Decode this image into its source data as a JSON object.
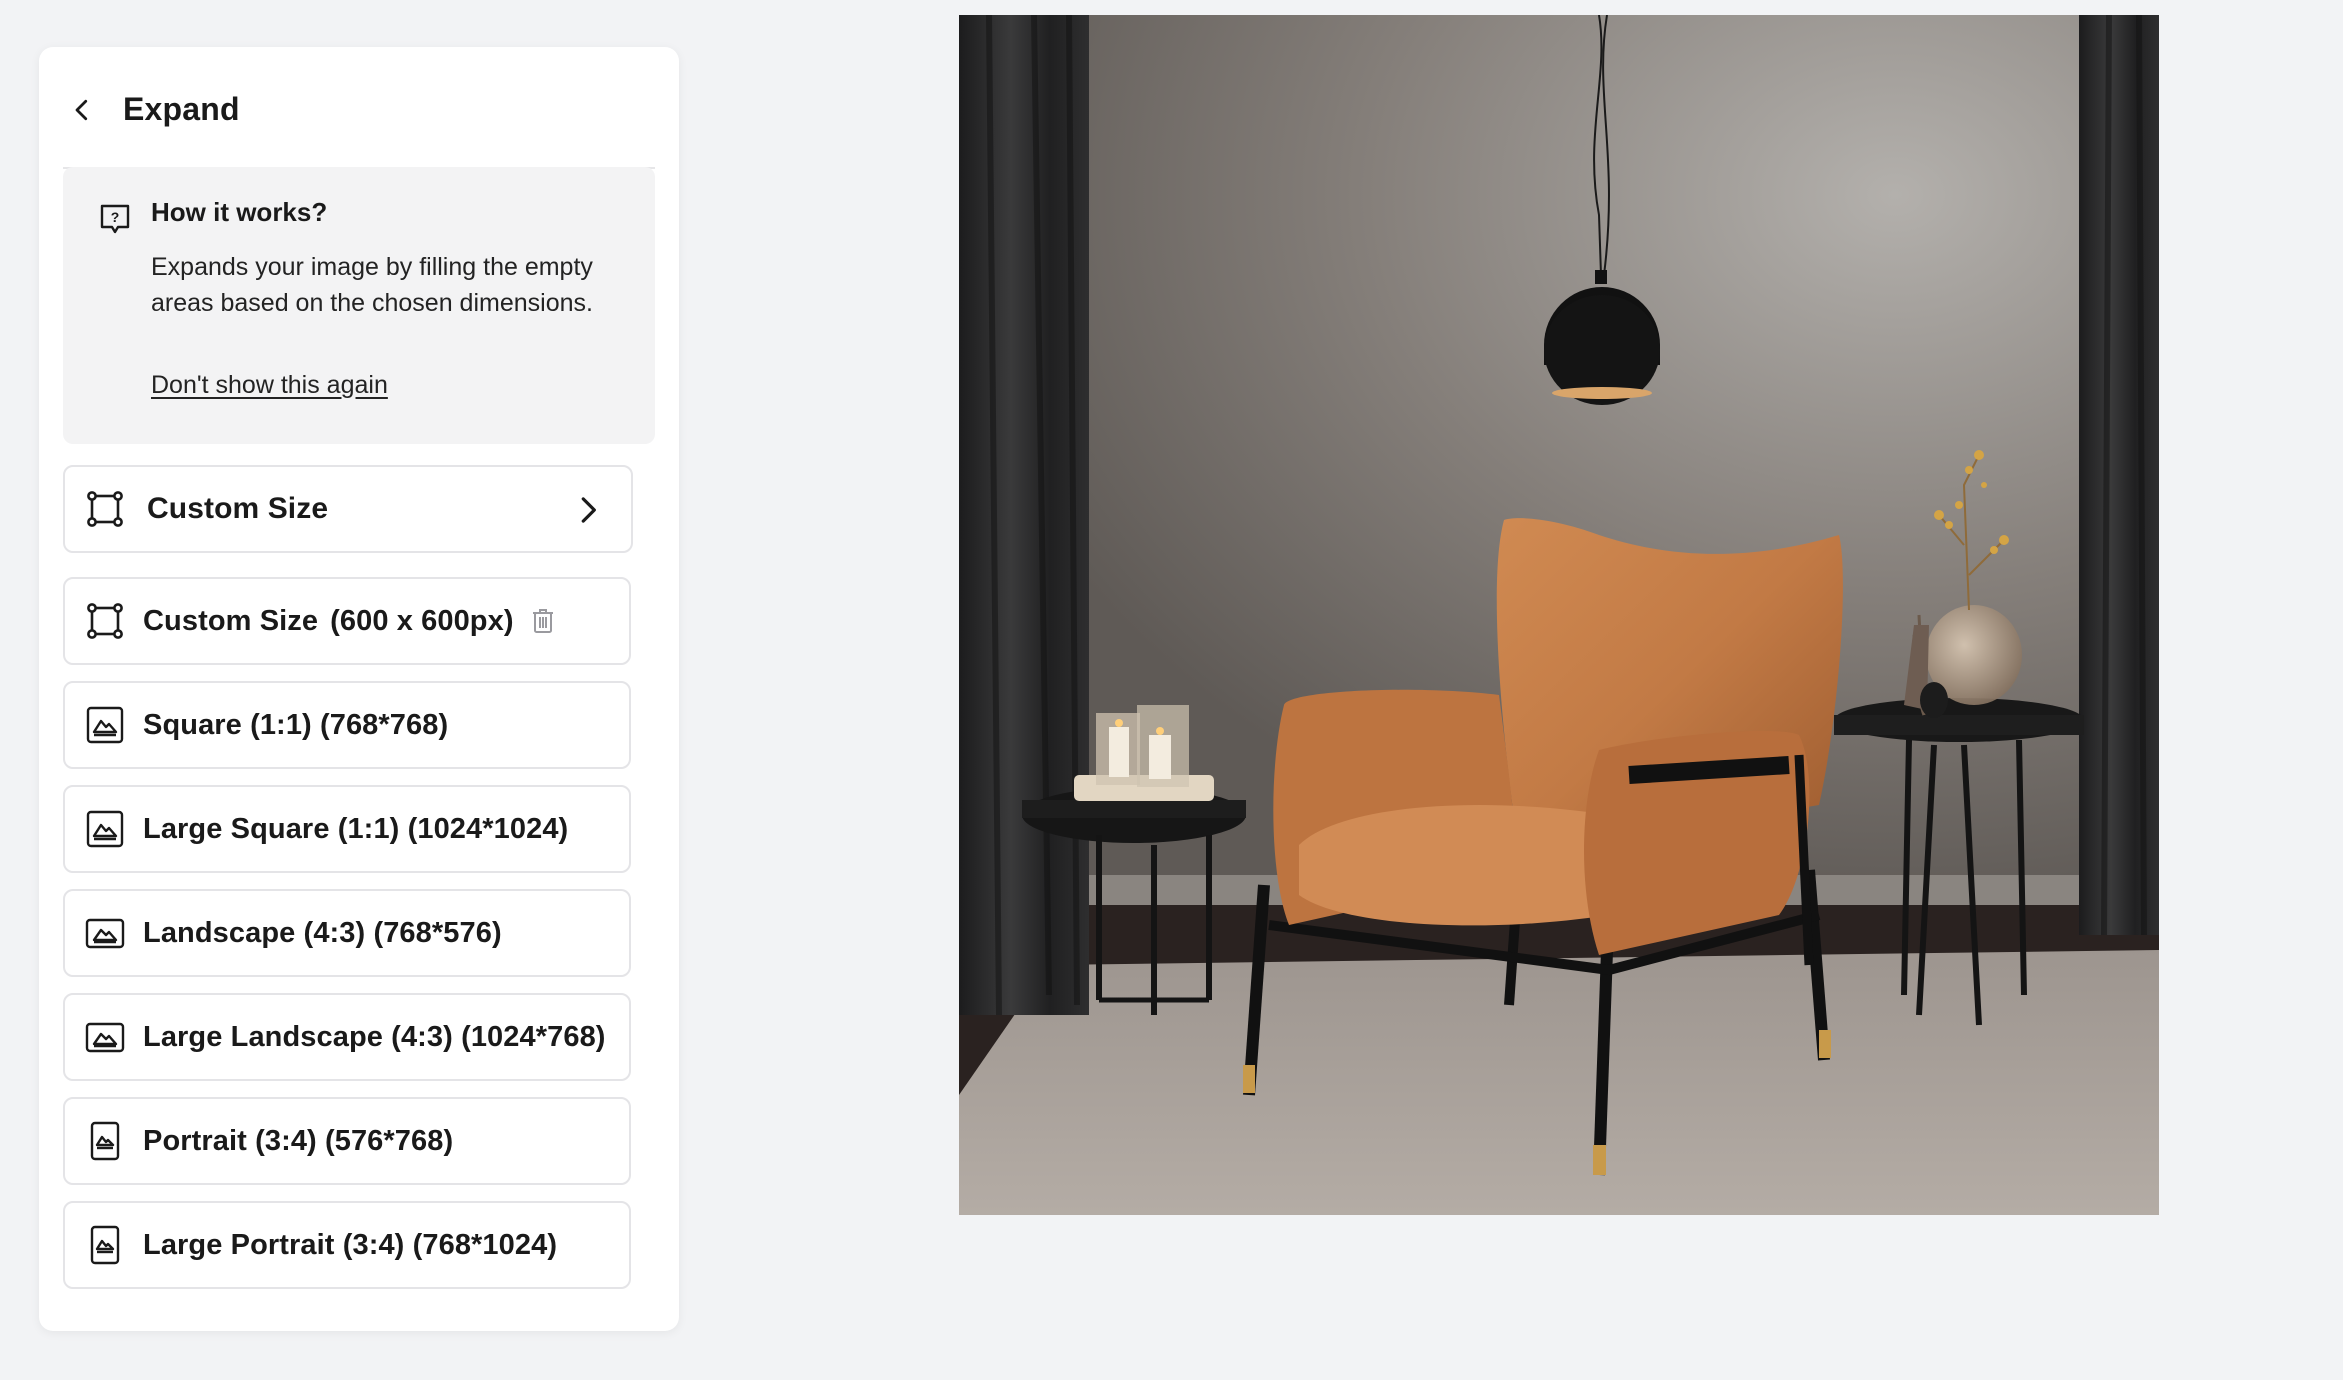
{
  "panel": {
    "title": "Expand",
    "info": {
      "title": "How it works?",
      "text": "Expands your image by filling the empty areas based on the chosen dimensions.",
      "link": "Don't show this again"
    },
    "custom_size_button": "Custom Size",
    "saved_custom": {
      "label": "Custom Size",
      "size": "(600 x 600px)"
    },
    "presets": [
      {
        "label": "Square (1:1) (768*768)",
        "icon": "image-square-icon"
      },
      {
        "label": "Large Square (1:1) (1024*1024)",
        "icon": "image-square-icon"
      },
      {
        "label": "Landscape (4:3) (768*576)",
        "icon": "image-landscape-icon"
      },
      {
        "label": "Large Landscape (4:3) (1024*768)",
        "icon": "image-landscape-icon"
      },
      {
        "label": "Portrait (3:4) (576*768)",
        "icon": "image-portrait-icon"
      },
      {
        "label": "Large Portrait (3:4) (768*1024)",
        "icon": "image-portrait-icon"
      }
    ]
  },
  "colors": {
    "panel_bg": "#ffffff",
    "page_bg": "#f2f3f5",
    "info_bg": "#f3f3f4",
    "border": "#e4e4e7",
    "text": "#1a1a1a",
    "chair": "#c27a45"
  }
}
